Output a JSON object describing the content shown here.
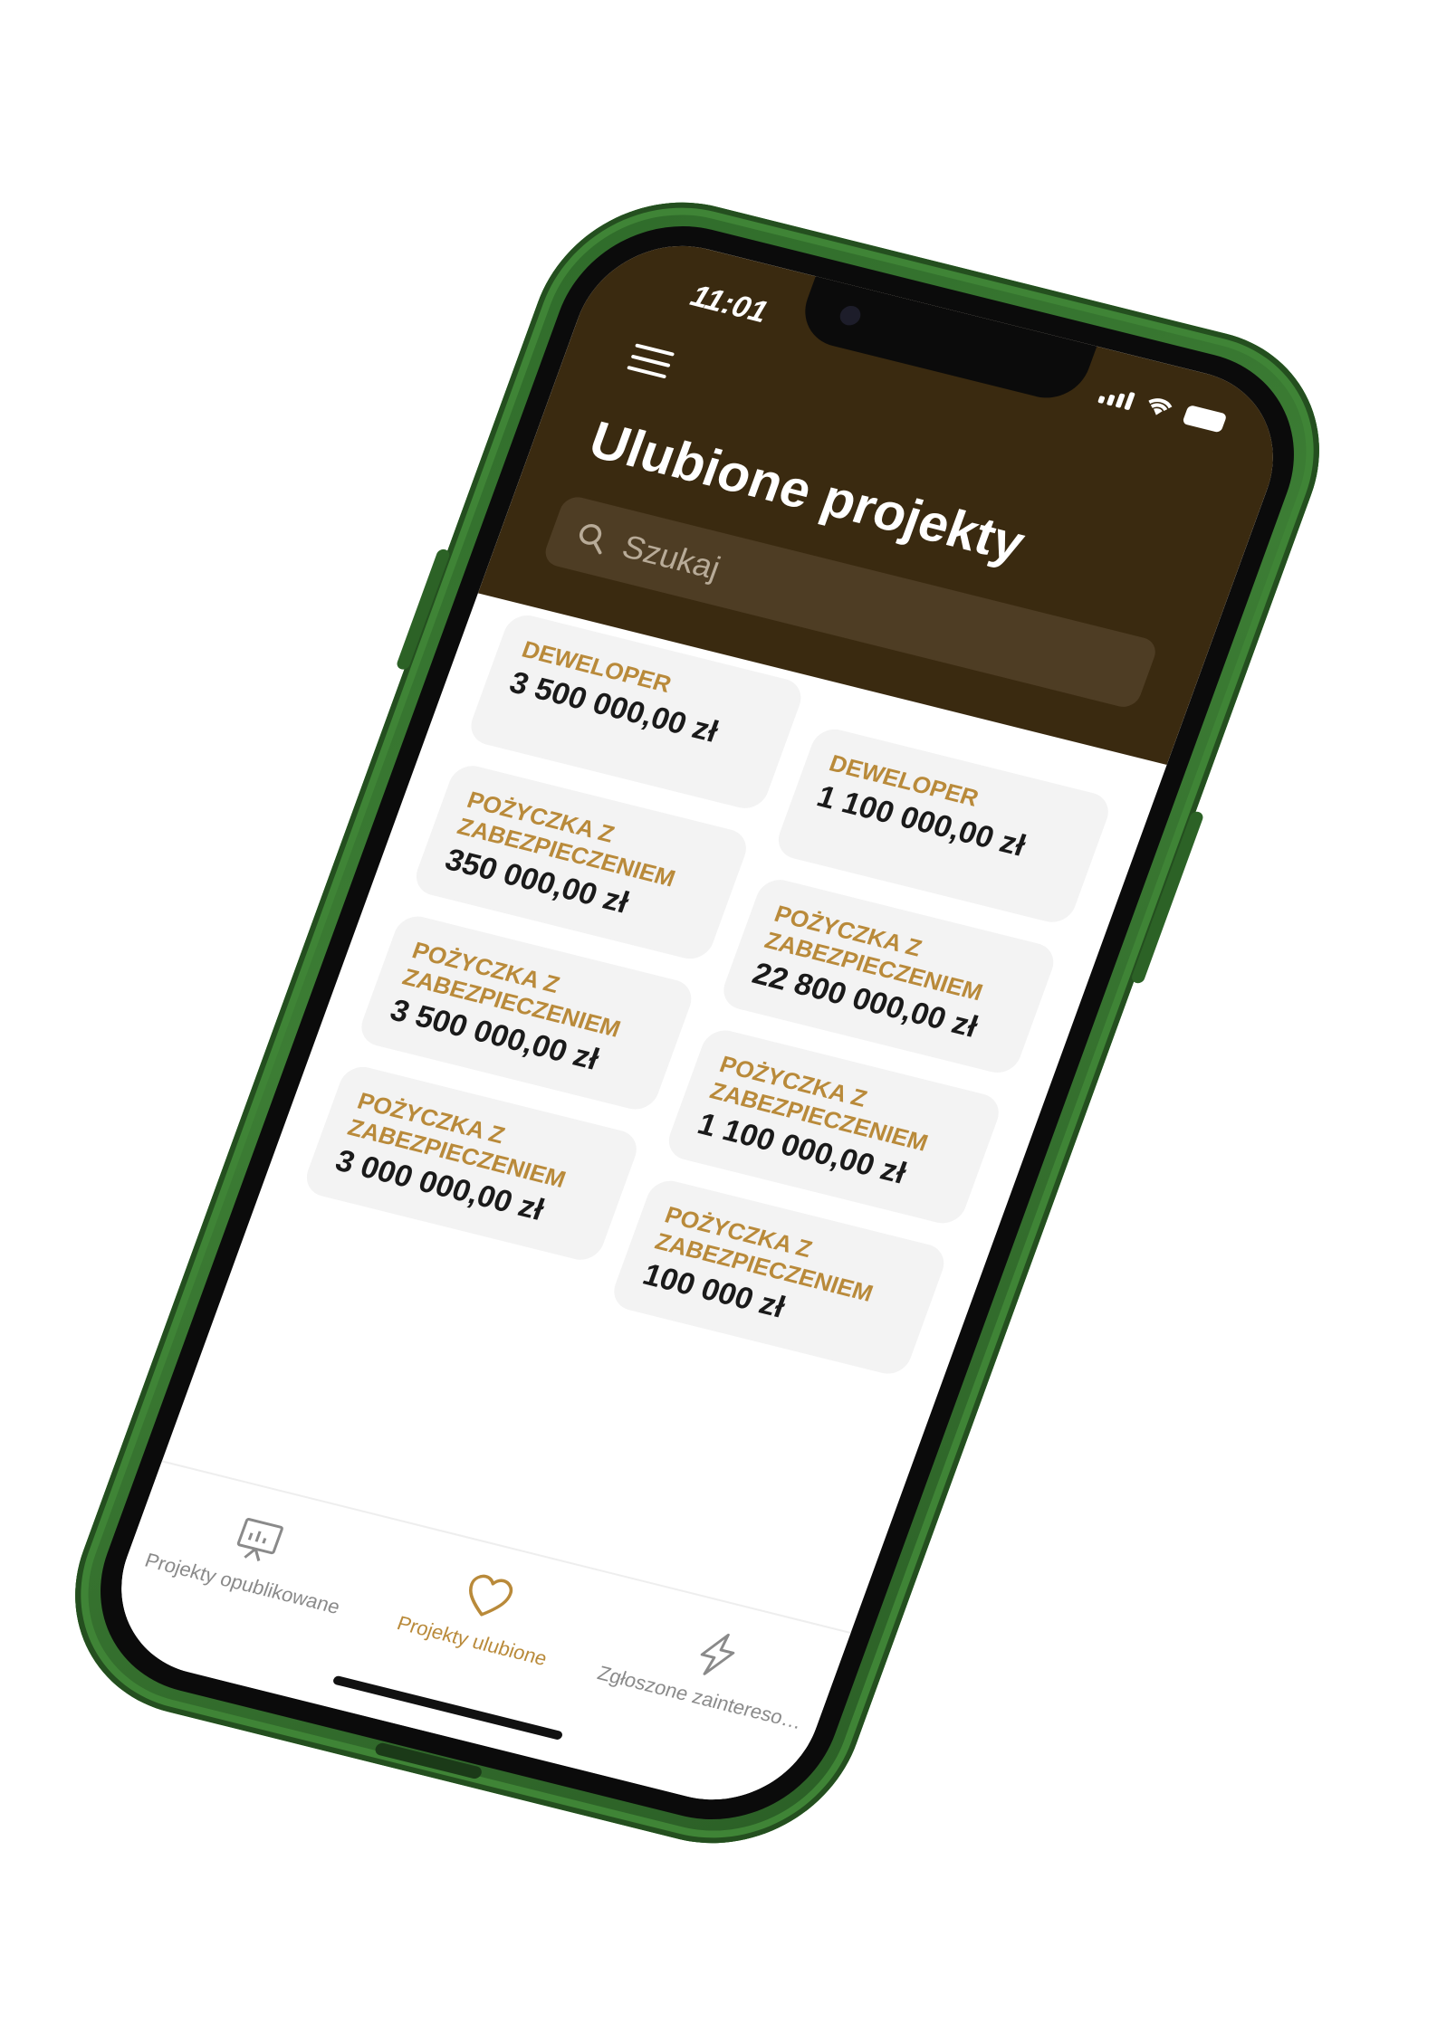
{
  "status_bar": {
    "time": "11:01"
  },
  "header": {
    "title": "Ulubione projekty",
    "search_placeholder": "Szukaj"
  },
  "cards": [
    {
      "category": "DEWELOPER",
      "amount": "3 500 000,00 zł"
    },
    {
      "category": "DEWELOPER",
      "amount": "1 100 000,00 zł"
    },
    {
      "category": "POŻYCZKA Z ZABEZPIECZENIEM",
      "amount": "350 000,00 zł"
    },
    {
      "category": "POŻYCZKA Z ZABEZPIECZENIEM",
      "amount": "22 800 000,00 zł"
    },
    {
      "category": "POŻYCZKA Z ZABEZPIECZENIEM",
      "amount": "3 500 000,00 zł"
    },
    {
      "category": "POŻYCZKA Z ZABEZPIECZENIEM",
      "amount": "1 100 000,00 zł"
    },
    {
      "category": "POŻYCZKA Z ZABEZPIECZENIEM",
      "amount": "3 000 000,00 zł"
    },
    {
      "category": "POŻYCZKA Z ZABEZPIECZENIEM",
      "amount": "100 000 zł"
    }
  ],
  "tabbar": {
    "tabs": [
      {
        "label": "Projekty opublikowane",
        "icon": "presentation-chart-icon",
        "active": false
      },
      {
        "label": "Projekty ulubione",
        "icon": "heart-icon",
        "active": true
      },
      {
        "label": "Zgłoszone zainteresow...",
        "icon": "lightning-icon",
        "active": false
      }
    ]
  },
  "colors": {
    "header_bg": "#3a2a10",
    "accent": "#b98a3a",
    "phone_body": "#3c7d34",
    "card_bg": "#f3f3f3"
  }
}
